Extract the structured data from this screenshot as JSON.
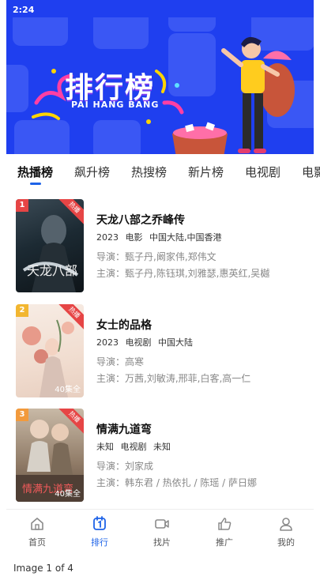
{
  "status_bar": {
    "time": "2:24"
  },
  "banner": {
    "title": "排行榜",
    "subtitle": "PAI HANG BANG"
  },
  "tabs": [
    {
      "label": "热播榜",
      "active": true
    },
    {
      "label": "飙升榜",
      "active": false
    },
    {
      "label": "热搜榜",
      "active": false
    },
    {
      "label": "新片榜",
      "active": false
    },
    {
      "label": "电视剧",
      "active": false
    },
    {
      "label": "电影",
      "active": false
    }
  ],
  "movies": [
    {
      "rank": "1",
      "rank_color": "#e64545",
      "hot_label": "热播",
      "episode_label": "",
      "title": "天龙八部之乔峰传",
      "year": "2023",
      "genre": "电影",
      "region": "中国大陆,中国香港",
      "director": "导演：甄子丹,阚家伟,郑伟文",
      "cast": "主演：甄子丹,陈钰琪,刘雅瑟,惠英红,吴樾"
    },
    {
      "rank": "2",
      "rank_color": "#f2b630",
      "hot_label": "热播",
      "episode_label": "40集全",
      "title": "女士的品格",
      "year": "2023",
      "genre": "电视剧",
      "region": "中国大陆",
      "director": "导演：高寒",
      "cast": "主演：万茜,刘敏涛,邢菲,白客,高一仁"
    },
    {
      "rank": "3",
      "rank_color": "#f29a3c",
      "hot_label": "热播",
      "episode_label": "40集全",
      "title": "情满九道弯",
      "year": "未知",
      "genre": "电视剧",
      "region": "未知",
      "director": "导演：刘家成",
      "cast": "主演：韩东君 / 热依扎 / 陈瑶 / 萨日娜"
    }
  ],
  "bottom_nav": [
    {
      "label": "首页",
      "icon": "home-icon",
      "active": false
    },
    {
      "label": "排行",
      "icon": "ranking-icon",
      "active": true
    },
    {
      "label": "找片",
      "icon": "video-icon",
      "active": false
    },
    {
      "label": "推广",
      "icon": "thumbs-up-icon",
      "active": false
    },
    {
      "label": "我的",
      "icon": "user-icon",
      "active": false
    }
  ],
  "caption": "Image 1 of 4",
  "colors": {
    "accent": "#1e63e8",
    "banner": "#1f3fef",
    "hot": "#e64545"
  }
}
